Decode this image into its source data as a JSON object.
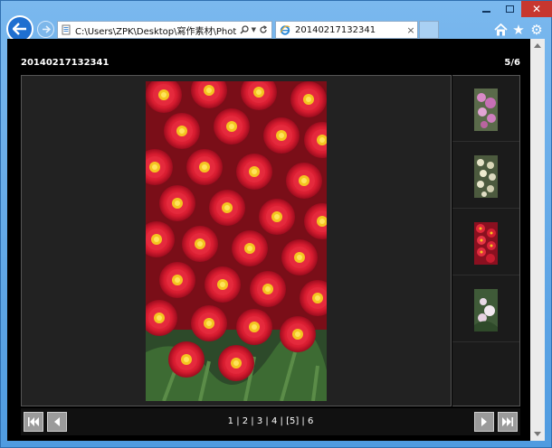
{
  "browser": {
    "address": "C:\\Users\\ZPK\\Desktop\\寫作素材\\Photo\\",
    "tab_title": "20140217132341",
    "tab_close": "×"
  },
  "gallery": {
    "title": "20140217132341",
    "counter": "5/6",
    "pages": [
      "1",
      "2",
      "3",
      "4",
      "[5]",
      "6"
    ],
    "separator": " | "
  },
  "icons": {
    "back": "back-arrow-icon",
    "forward": "forward-arrow-icon",
    "search": "search-icon",
    "refresh": "refresh-icon",
    "home": "home-icon",
    "favorites": "star-icon",
    "tools": "gear-icon",
    "first": "first-page-icon",
    "prev": "previous-icon",
    "next": "next-icon",
    "last": "last-page-icon"
  },
  "colors": {
    "accent": "#1f6fd0",
    "viewer_bg": "#222222",
    "close_red": "#c7372f"
  }
}
